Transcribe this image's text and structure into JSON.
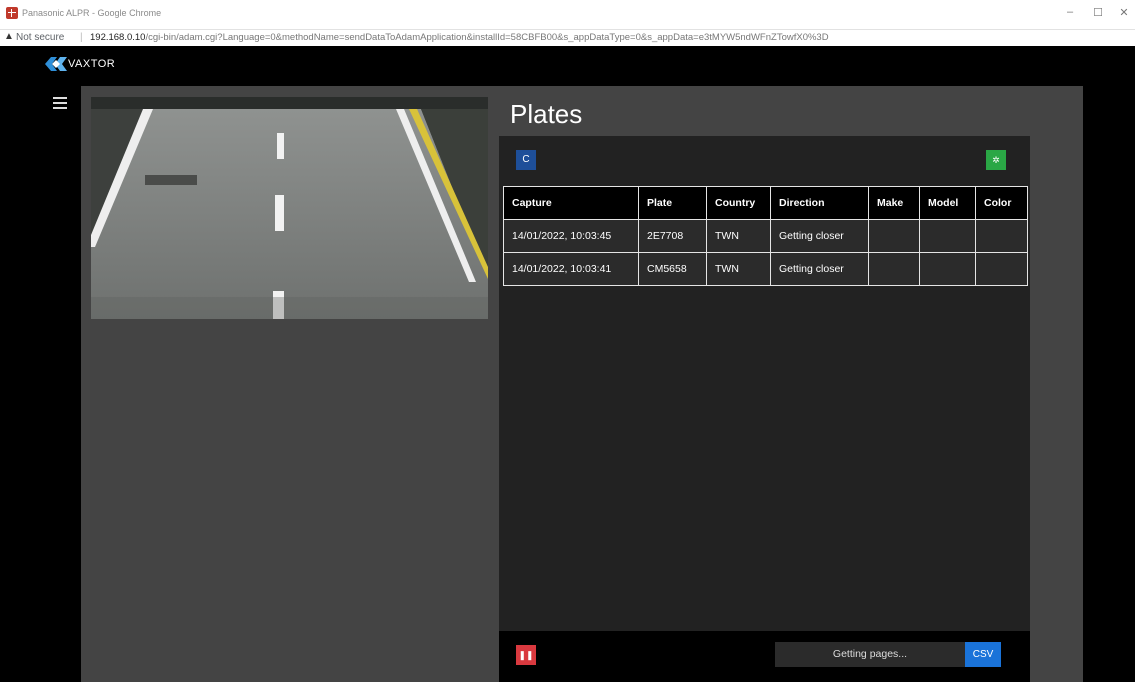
{
  "window": {
    "title": "Panasonic ALPR - Google Chrome",
    "controls": {
      "minimize": "–",
      "maximize": "☐",
      "close": "✕"
    }
  },
  "address_bar": {
    "security_label": "Not secure",
    "separator": "|",
    "host": "192.168.0.10",
    "path": "/cgi-bin/adam.cgi?Language=0&methodName=sendDataToAdamApplication&installId=58CBFB00&s_appDataType=0&s_appData=e3tMYW5ndWFnZTowfX0%3D"
  },
  "header": {
    "logo_text": "VAXTOR"
  },
  "plates": {
    "title": "Plates",
    "refresh_icon": "C",
    "settings_icon": "✲",
    "columns": [
      "Capture",
      "Plate",
      "Country",
      "Direction",
      "Make",
      "Model",
      "Color"
    ],
    "rows": [
      [
        "14/01/2022, 10:03:45",
        "2E7708",
        "TWN",
        "Getting closer",
        "",
        "",
        ""
      ],
      [
        "14/01/2022, 10:03:41",
        "CM5658",
        "TWN",
        "Getting closer",
        "",
        "",
        ""
      ]
    ],
    "pause_icon": "❚❚",
    "status_text": "Getting pages...",
    "csv_label": "CSV"
  },
  "colors": {
    "refresh_button": "#1e4f99",
    "settings_button": "#2aa745",
    "pause_button": "#d9393f",
    "csv_button": "#1a73d9",
    "logo_accent": "#2f8fd8"
  }
}
